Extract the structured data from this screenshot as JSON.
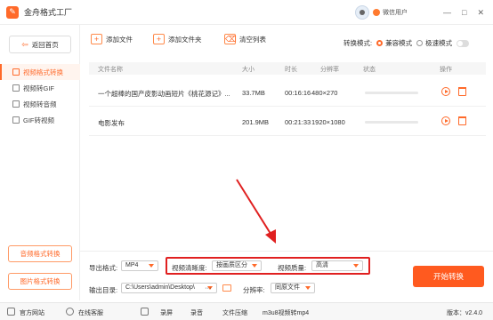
{
  "window": {
    "title": "金舟格式工厂",
    "user_name": "微信用户",
    "controls": [
      "—",
      "□",
      "✕"
    ]
  },
  "sidebar": {
    "home_label": "返回首页",
    "items": [
      {
        "label": "视频格式转换",
        "active": true
      },
      {
        "label": "视频转GIF",
        "active": false
      },
      {
        "label": "视频转音频",
        "active": false
      },
      {
        "label": "GIF转视频",
        "active": false
      }
    ],
    "bottom_buttons": [
      "音频格式转换",
      "图片格式转换"
    ]
  },
  "toolbar": {
    "add_file": "添加文件",
    "add_folder": "添加文件夹",
    "clear_list": "清空列表",
    "mode_label": "转换模式:",
    "mode_compat": "兼容模式",
    "mode_fast": "极速模式"
  },
  "table": {
    "headers": {
      "name": "文件名称",
      "size": "大小",
      "duration": "时长",
      "resolution": "分辨率",
      "status": "状态",
      "actions": "操作"
    },
    "rows": [
      {
        "name": "一个超棒的国产皮影动画短片《桃花源记》...",
        "size": "33.7MB",
        "duration": "00:16:16",
        "resolution": "480×270",
        "progress": 0
      },
      {
        "name": "电影发布",
        "size": "201.9MB",
        "duration": "00:21:33",
        "resolution": "1920×1080",
        "progress": 0
      }
    ]
  },
  "settings": {
    "export_format_label": "导出格式:",
    "export_format_value": "MP4",
    "clarity_label": "视频清晰度:",
    "clarity_value": "按画质区分",
    "quality_label": "视频质量:",
    "quality_value": "高清",
    "output_dir_label": "输出目录:",
    "output_dir_value": "C:\\Users\\admin\\Desktop\\",
    "more": "···",
    "resolution_label": "分辨率:",
    "resolution_value": "同原文件",
    "start_button": "开始转换"
  },
  "statusbar": {
    "website": "官方网站",
    "support": "在线客服",
    "record_screen": "录屏",
    "record_audio": "录音",
    "compress": "文件压缩",
    "m3u8": "m3u8视频转mp4",
    "version": "版本：v2.4.0"
  },
  "colors": {
    "accent": "#ff6a2a",
    "highlight_box": "#e02020"
  }
}
